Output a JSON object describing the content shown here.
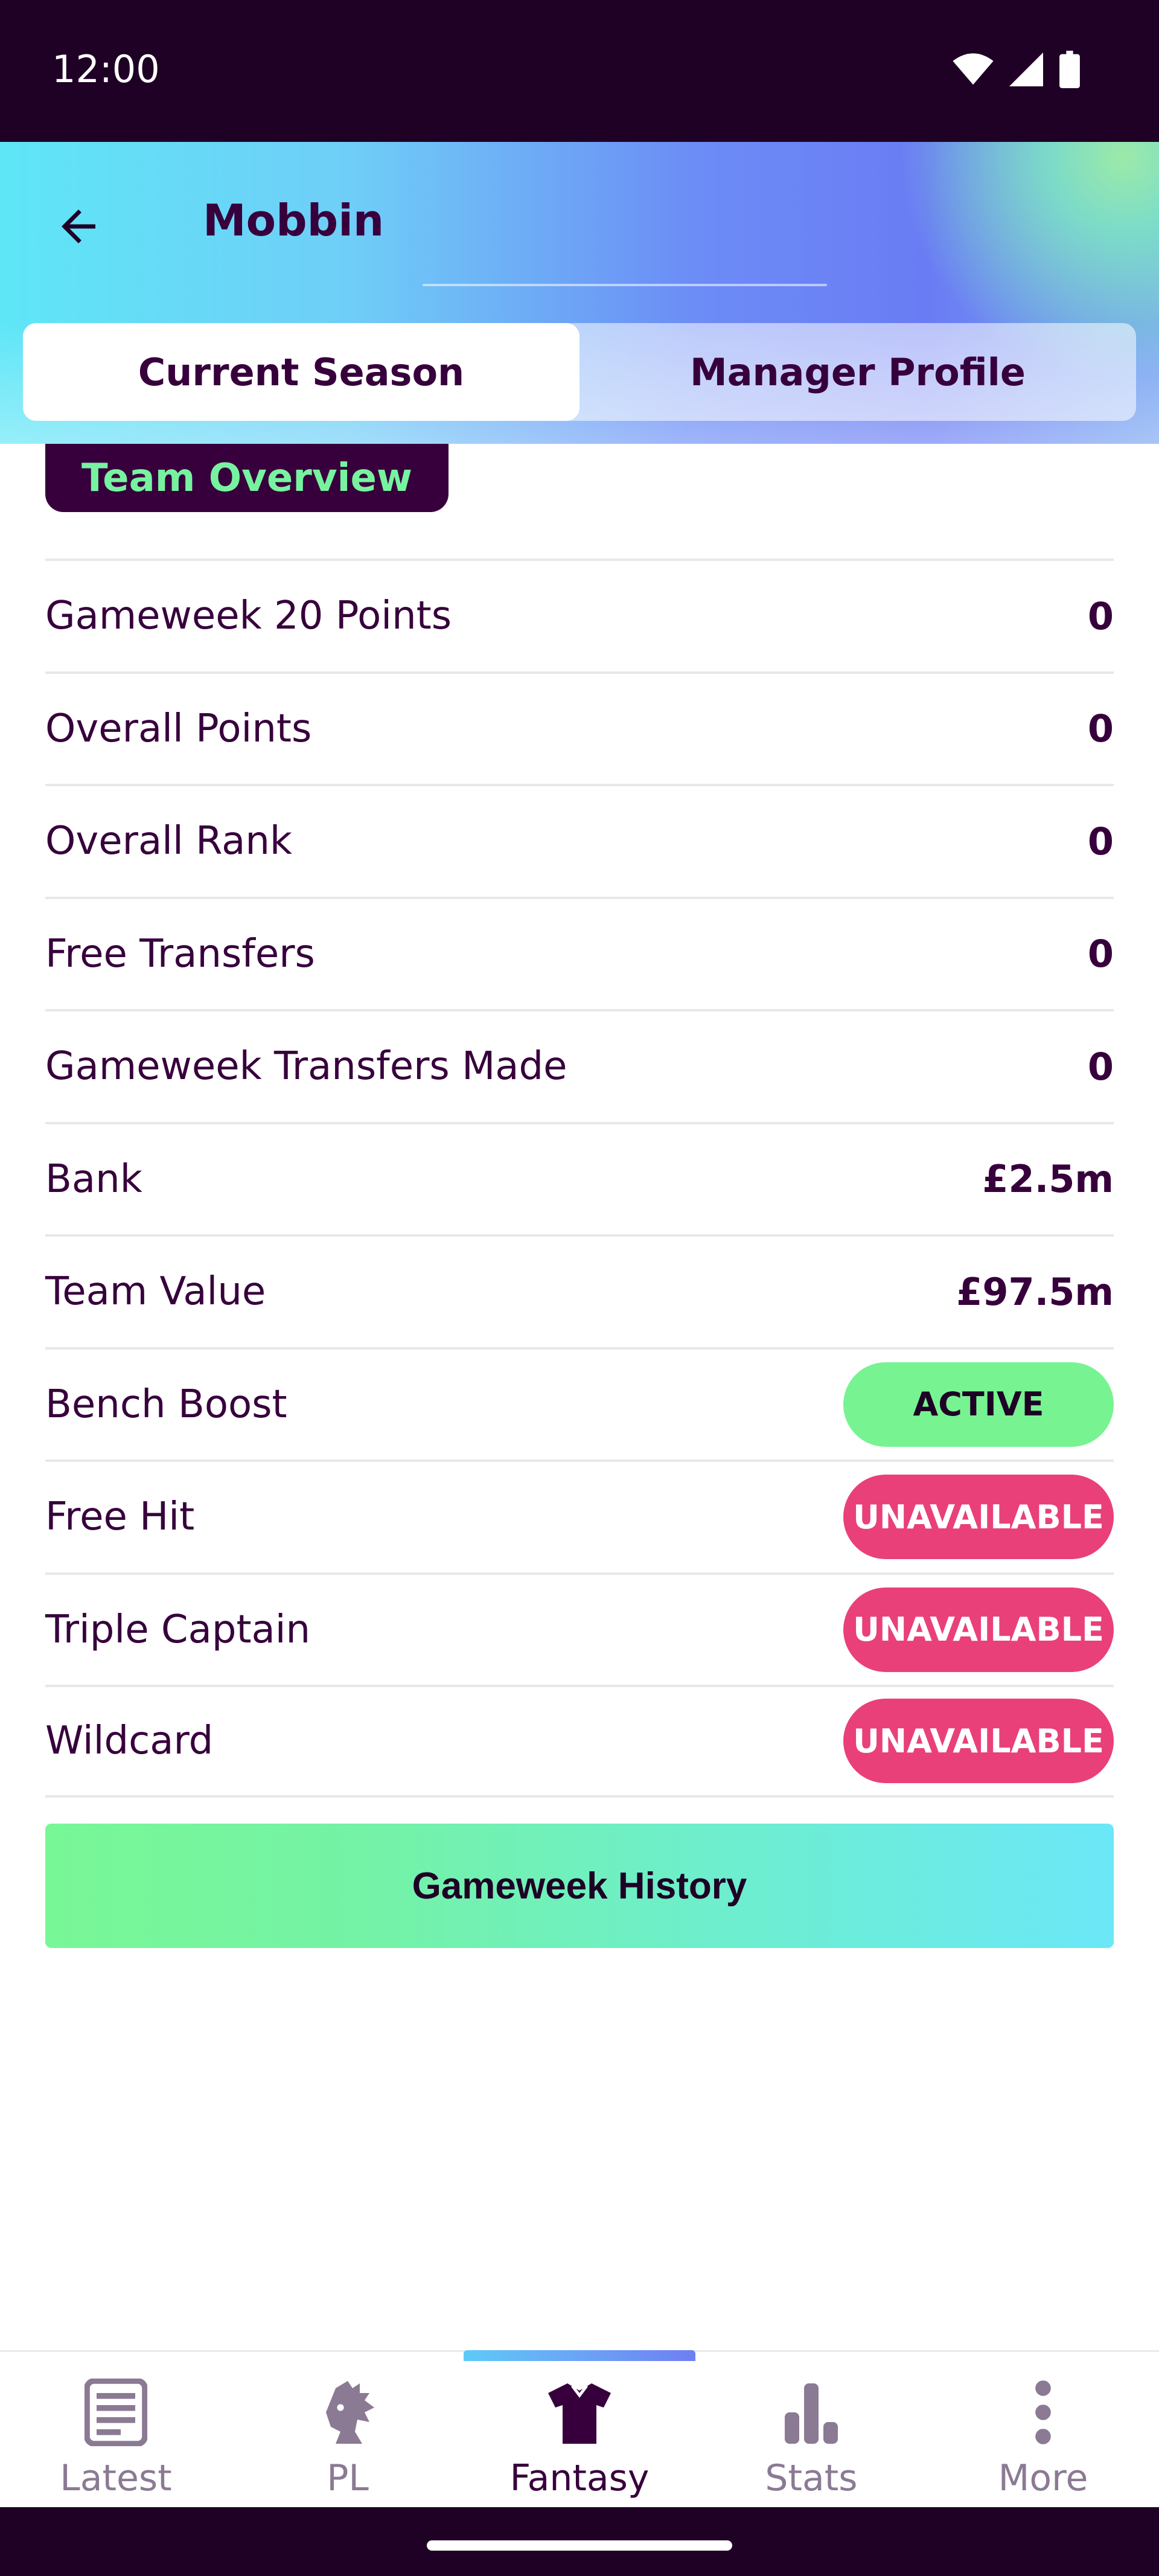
{
  "status_bar": {
    "time": "12:00"
  },
  "header": {
    "title": "Mobbin"
  },
  "tabs": [
    {
      "label": "Current Season",
      "active": true
    },
    {
      "label": "Manager Profile",
      "active": false
    }
  ],
  "section": {
    "title": "Team Overview"
  },
  "stats": [
    {
      "label": "Gameweek 20 Points",
      "value": "0"
    },
    {
      "label": "Overall Points",
      "value": "0"
    },
    {
      "label": "Overall Rank",
      "value": "0"
    },
    {
      "label": "Free Transfers",
      "value": "0"
    },
    {
      "label": "Gameweek Transfers Made",
      "value": "0"
    },
    {
      "label": "Bank",
      "value": "£2.5m"
    },
    {
      "label": "Team Value",
      "value": "£97.5m"
    }
  ],
  "chips": [
    {
      "label": "Bench Boost",
      "status": "ACTIVE"
    },
    {
      "label": "Free Hit",
      "status": "UNAVAILABLE"
    },
    {
      "label": "Triple Captain",
      "status": "UNAVAILABLE"
    },
    {
      "label": "Wildcard",
      "status": "UNAVAILABLE"
    }
  ],
  "history_button": {
    "label": "Gameweek History"
  },
  "bottom_nav": [
    {
      "label": "Latest",
      "icon": "news-icon",
      "active": false
    },
    {
      "label": "PL",
      "icon": "lion-icon",
      "active": false
    },
    {
      "label": "Fantasy",
      "icon": "shirt-icon",
      "active": true
    },
    {
      "label": "Stats",
      "icon": "bar-chart-icon",
      "active": false
    },
    {
      "label": "More",
      "icon": "more-vertical-icon",
      "active": false
    }
  ],
  "colors": {
    "brand_purple": "#37003c",
    "active_green": "#77f391",
    "unavailable_pink": "#e9407a",
    "accent_cyan": "#6be7f8"
  }
}
